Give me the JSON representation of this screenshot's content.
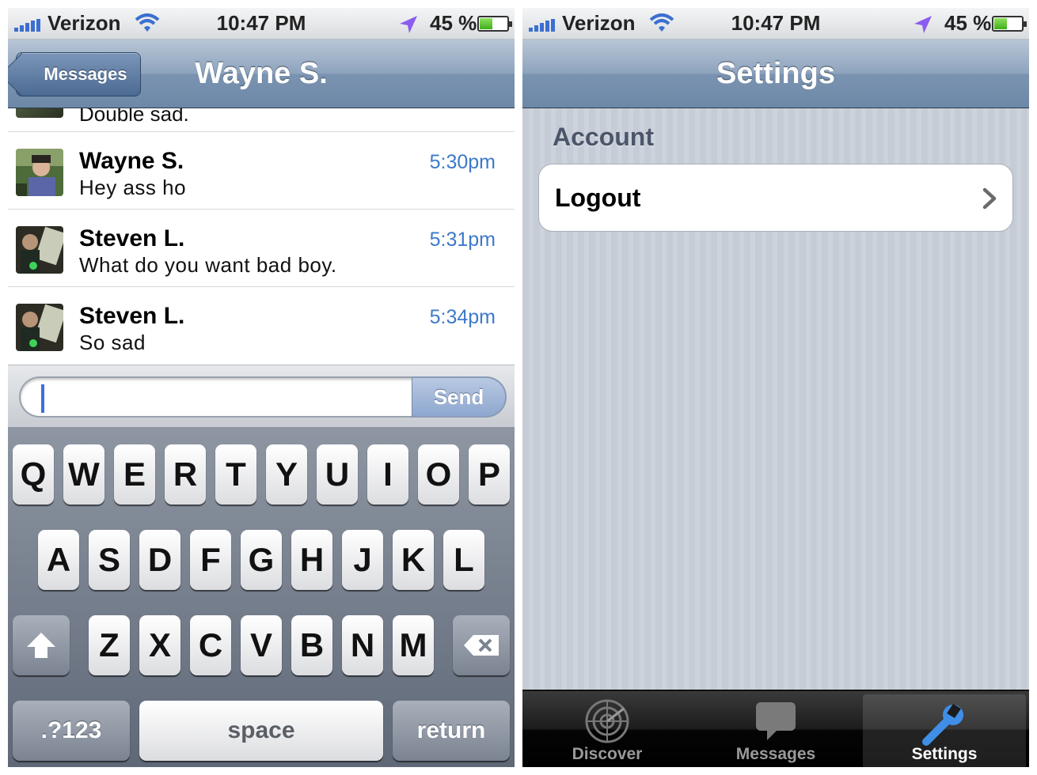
{
  "status_bar": {
    "carrier": "Verizon",
    "time": "10:47 PM",
    "battery_text": "45 %",
    "battery_level": 0.45,
    "signal_icon": "signal-bars-icon",
    "wifi_icon": "wifi-icon",
    "location_icon": "location-arrow-icon"
  },
  "left_screen": {
    "nav": {
      "back_label": "Messages",
      "title": "Wayne S."
    },
    "partial_message": "Double sad.",
    "messages": [
      {
        "name": "Wayne S.",
        "text": "Hey ass ho",
        "time": "5:30pm"
      },
      {
        "name": "Steven L.",
        "text": "What do you want bad boy.",
        "time": "5:31pm"
      },
      {
        "name": "Steven L.",
        "text": "So sad",
        "time": "5:34pm"
      }
    ],
    "composer": {
      "value": "",
      "send_label": "Send"
    },
    "keyboard": {
      "row1": [
        "Q",
        "W",
        "E",
        "R",
        "T",
        "Y",
        "U",
        "I",
        "O",
        "P"
      ],
      "row2": [
        "A",
        "S",
        "D",
        "F",
        "G",
        "H",
        "J",
        "K",
        "L"
      ],
      "row3": [
        "Z",
        "X",
        "C",
        "V",
        "B",
        "N",
        "M"
      ],
      "numbers_label": ".?123",
      "space_label": "space",
      "return_label": "return",
      "shift_icon": "shift-arrow-icon",
      "delete_icon": "backspace-icon"
    }
  },
  "right_screen": {
    "nav": {
      "title": "Settings"
    },
    "section_header": "Account",
    "rows": [
      {
        "label": "Logout",
        "icon": "chevron-right-icon"
      }
    ],
    "tabs": [
      {
        "label": "Discover",
        "icon": "radar-icon",
        "active": false
      },
      {
        "label": "Messages",
        "icon": "speech-bubble-icon",
        "active": false
      },
      {
        "label": "Settings",
        "icon": "wrench-icon",
        "active": true
      }
    ]
  },
  "colors": {
    "time_link": "#3d79c9",
    "nav_bar": "#8da3bd",
    "caret": "#3c6fe0"
  }
}
